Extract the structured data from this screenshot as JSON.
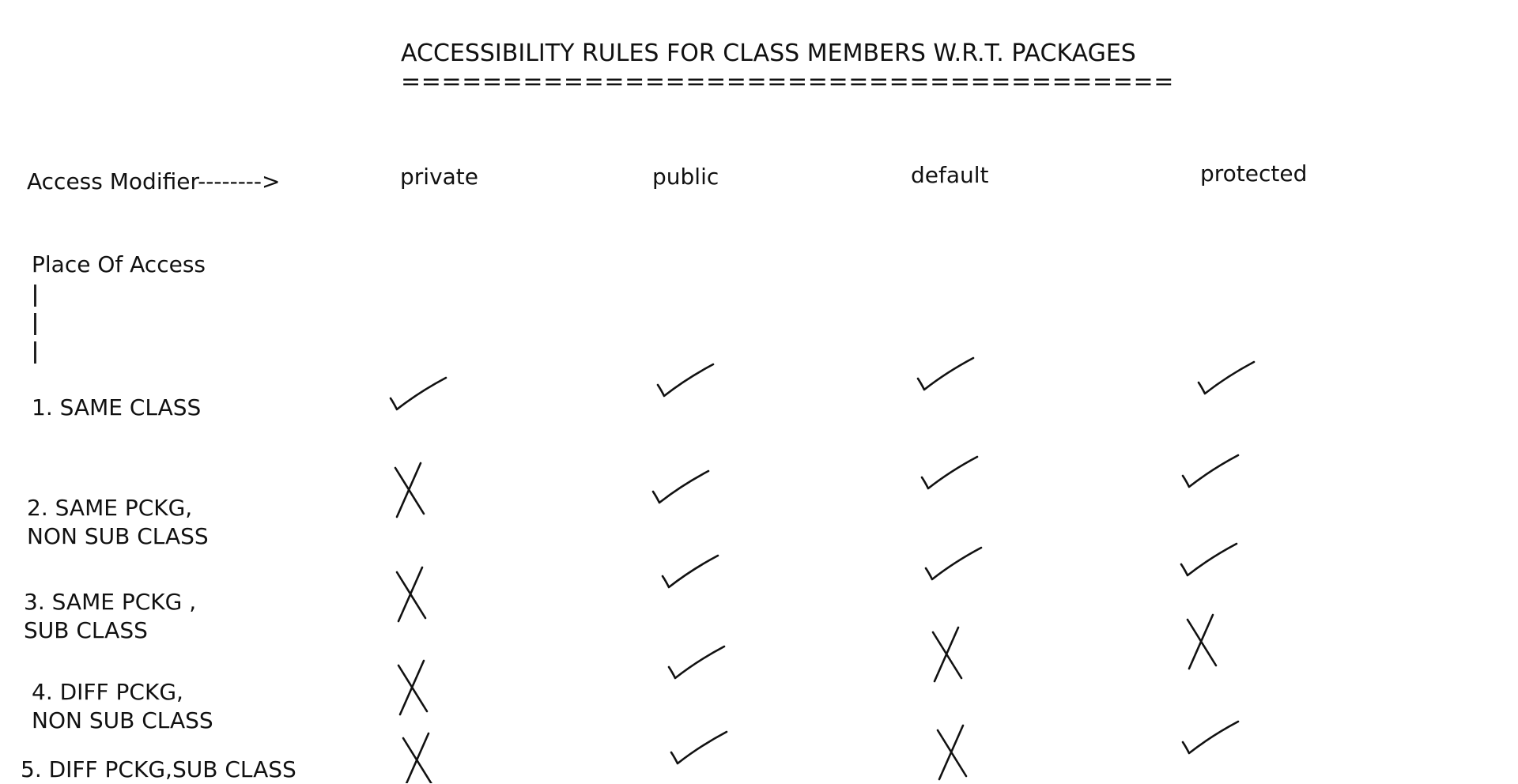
{
  "title": "ACCESSIBILITY RULES FOR CLASS MEMBERS W.R.T. PACKAGES",
  "title_underline": "======================================",
  "modifier_header": "Access Modifier-------->",
  "place_header": "Place Of Access",
  "modifiers": [
    "private",
    "public",
    "default",
    "protected"
  ],
  "rows": [
    {
      "label": "1. SAME CLASS",
      "access": [
        true,
        true,
        true,
        true
      ]
    },
    {
      "label": "2. SAME PCKG,\nNON SUB CLASS",
      "access": [
        false,
        true,
        true,
        true
      ]
    },
    {
      "label": "3. SAME PCKG ,\nSUB CLASS",
      "access": [
        false,
        true,
        true,
        true
      ]
    },
    {
      "label": "4. DIFF PCKG,\nNON SUB CLASS",
      "access": [
        false,
        true,
        false,
        false
      ]
    },
    {
      "label": "5. DIFF PCKG,SUB CLASS",
      "access": [
        false,
        true,
        false,
        true
      ]
    }
  ]
}
